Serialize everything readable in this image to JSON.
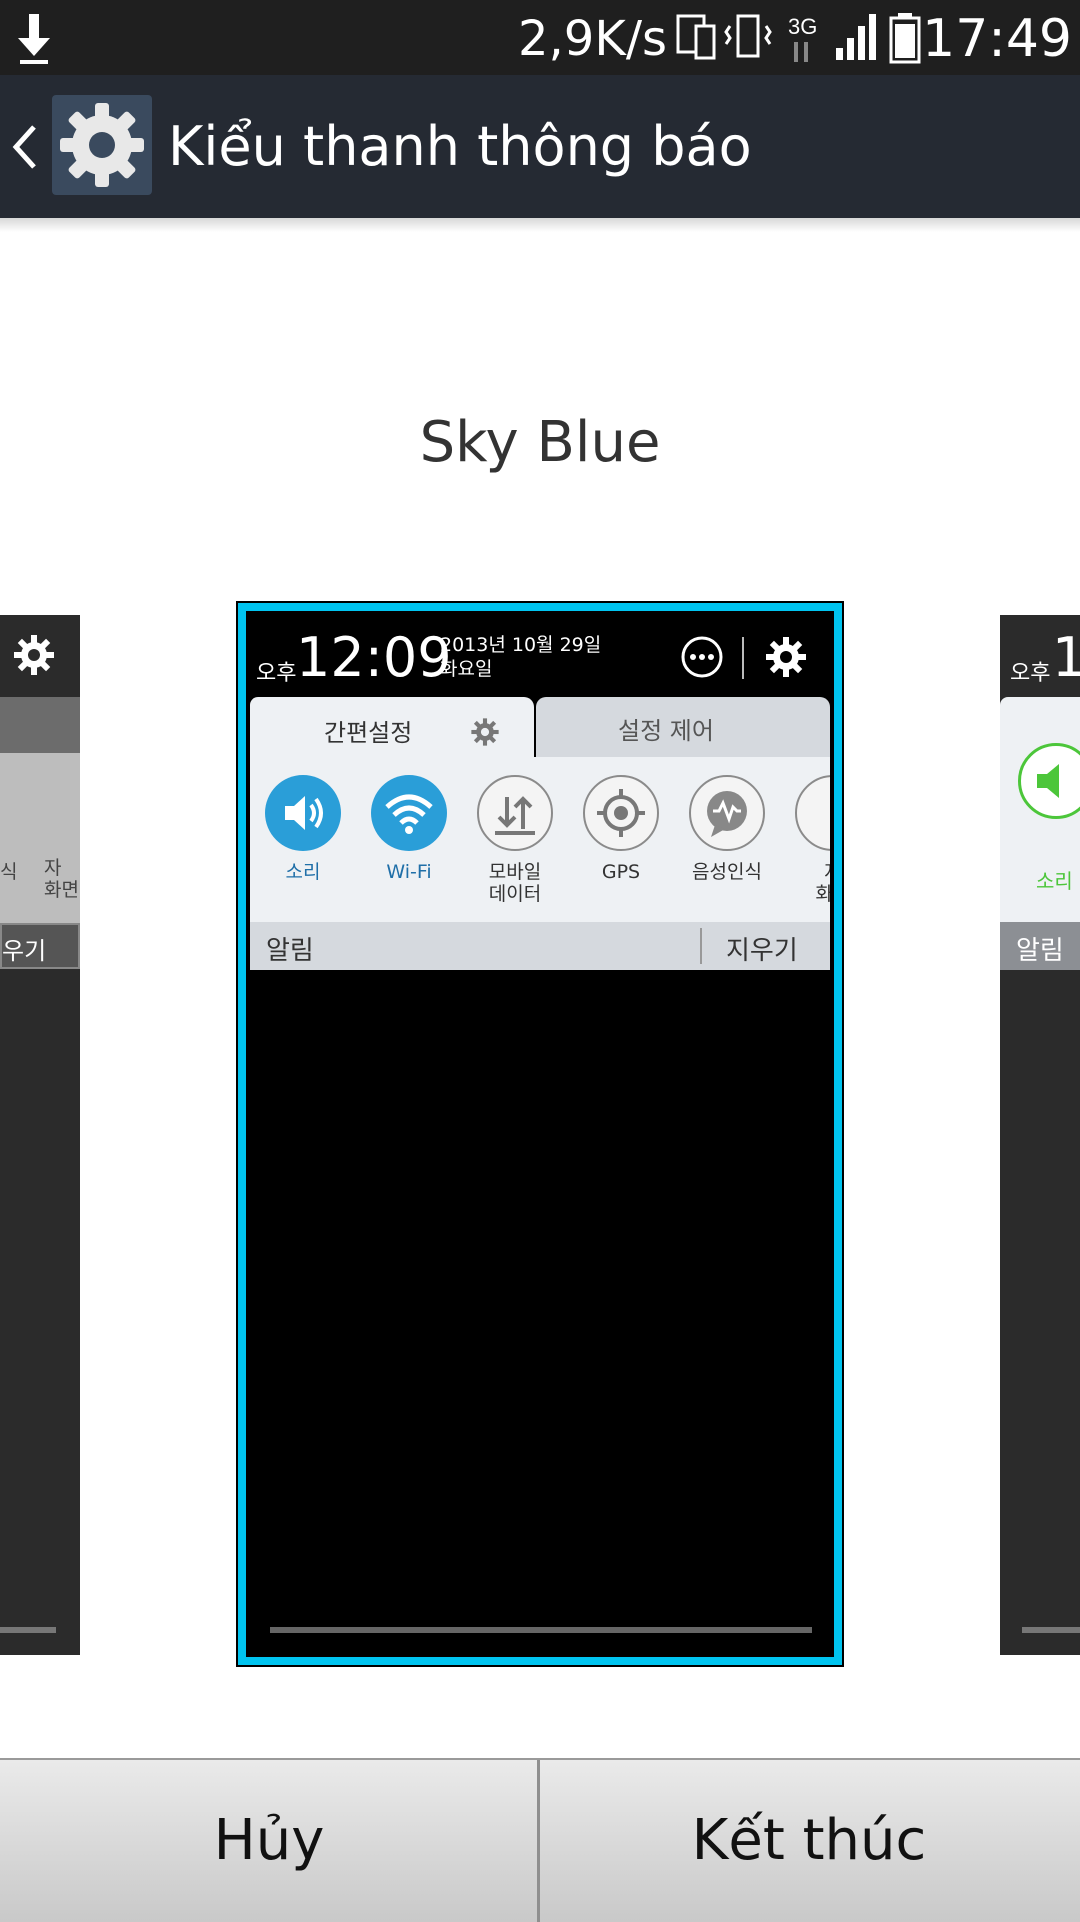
{
  "status_bar": {
    "speed": "2,9K/s",
    "network": "3G",
    "time": "17:49"
  },
  "action_bar": {
    "title": "Kiểu thanh thông báo",
    "icon": "settings-gear-icon"
  },
  "theme_name": "Sky Blue",
  "preview": {
    "ampm": "오후",
    "time": "12:09",
    "date_line1": "2013년 10월 29일",
    "date_line2": "화요일",
    "tab_active": "간편설정",
    "tab_inactive": "설정 제어",
    "quick_settings": [
      {
        "label": "소리",
        "state": "on",
        "icon": "sound-icon"
      },
      {
        "label": "Wi-Fi",
        "state": "on",
        "icon": "wifi-icon"
      },
      {
        "label": "모바일\n데이터",
        "state": "off",
        "icon": "mobile-data-icon"
      },
      {
        "label": "GPS",
        "state": "off",
        "icon": "gps-icon"
      },
      {
        "label": "음성인식",
        "state": "off",
        "icon": "voice-recognition-icon"
      },
      {
        "label": "자\n화면",
        "state": "off",
        "icon": "screen-icon"
      }
    ],
    "notifications_label": "알림",
    "clear_label": "지우기",
    "accent_color": "#00c4f0"
  },
  "side_left": {
    "label_a": "식",
    "label_b": "자\n화면",
    "clear_fragment": "우기"
  },
  "side_right": {
    "ampm": "오후",
    "time_fragment": "1",
    "sound_label": "소리",
    "notifications_label": "알림"
  },
  "buttons": {
    "cancel": "Hủy",
    "finish": "Kết thúc"
  }
}
